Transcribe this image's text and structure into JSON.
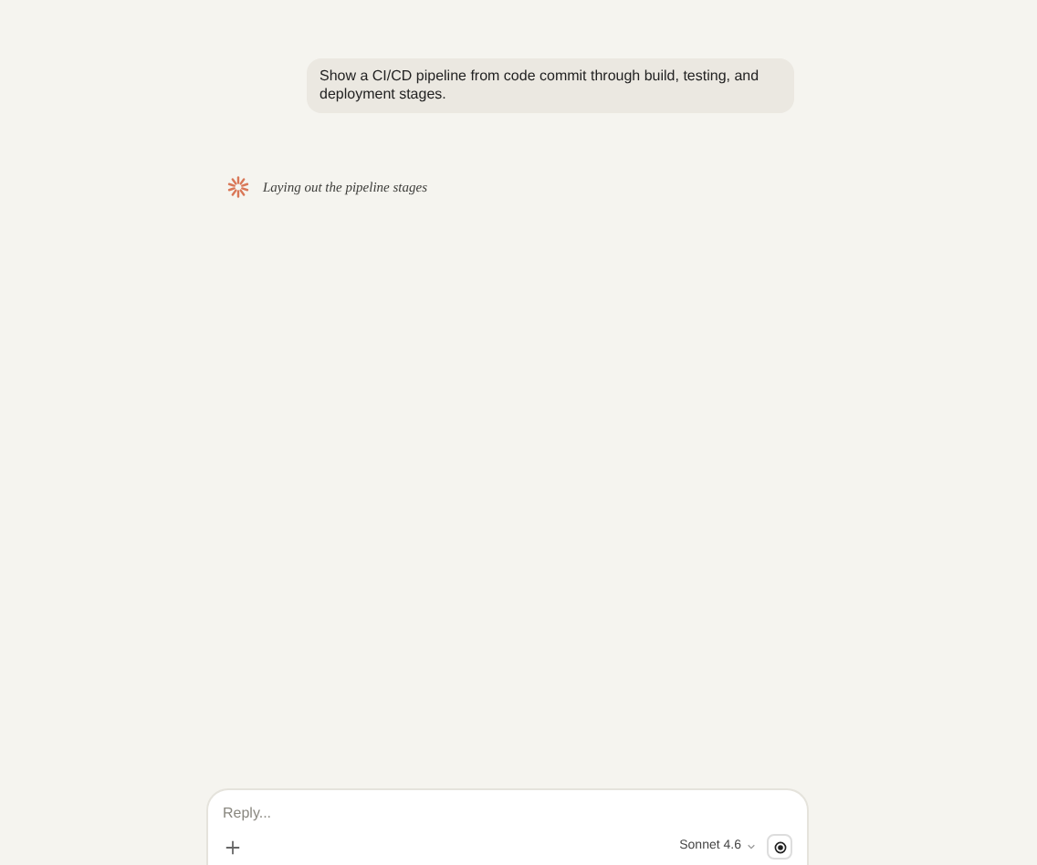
{
  "user_message": "Show a CI/CD pipeline from code commit through build, testing, and deployment stages.",
  "status": "Laying out the pipeline stages",
  "composer": {
    "placeholder": "Reply...",
    "model": "Sonnet 4.6"
  }
}
